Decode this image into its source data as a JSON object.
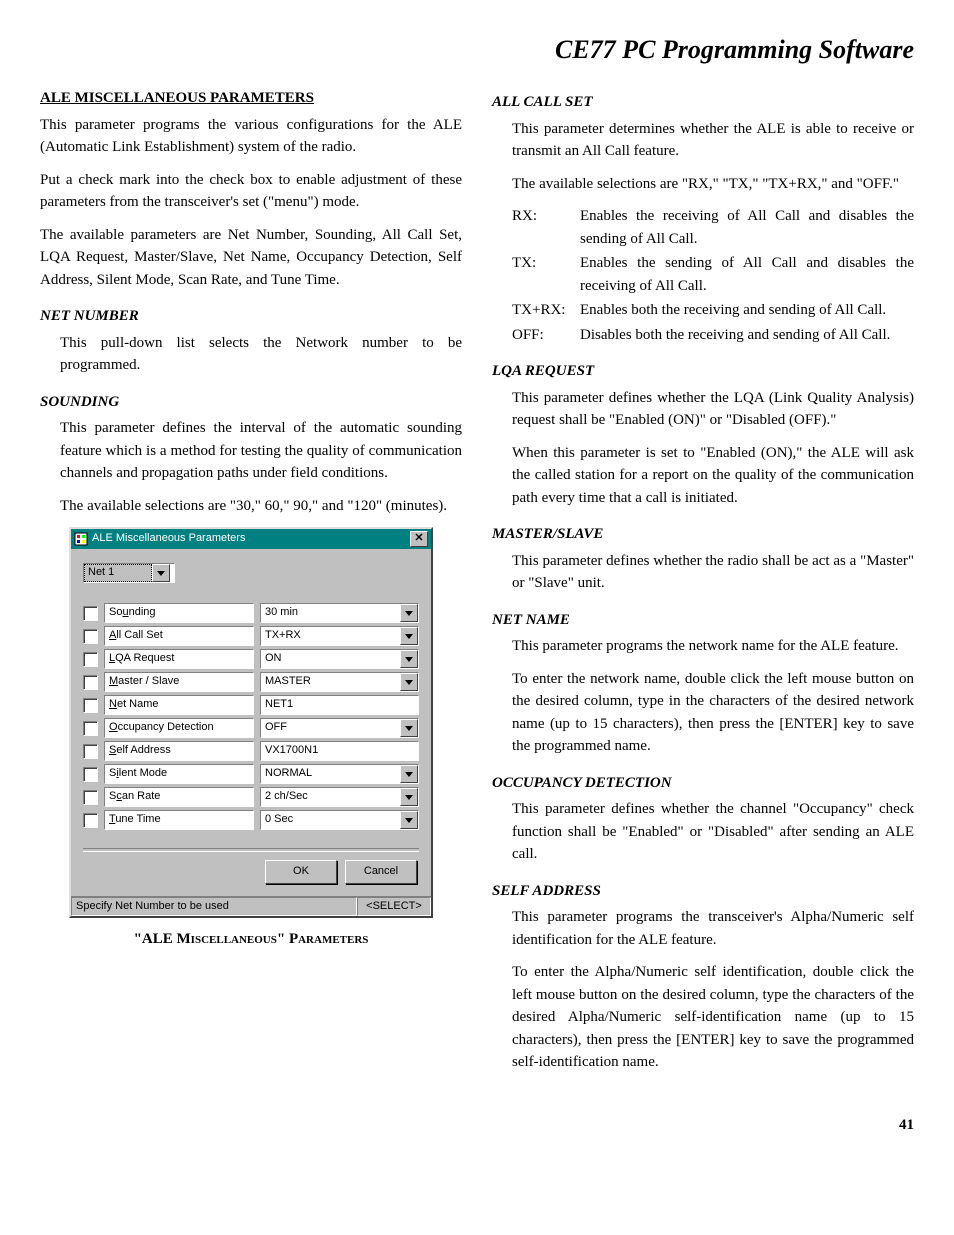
{
  "mainTitle": "CE77 PC Programming Software",
  "pageNumber": "41",
  "left": {
    "h1": "ALE MISCELLANEOUS PARAMETERS",
    "p1": "This parameter programs the various configurations for the ALE (Automatic Link Establishment) system of the radio.",
    "p2": "Put a check mark into the check box to enable adjustment of these parameters from the transceiver's set (\"menu\") mode.",
    "p3": "The available parameters are Net Number, Sounding, All Call Set, LQA Request, Master/Slave, Net Name, Occupancy Detection, Self Address, Silent Mode, Scan Rate, and Tune Time.",
    "netNumber": {
      "title": "NET NUMBER",
      "p1": "This pull-down list selects the Network number to be programmed."
    },
    "sounding": {
      "title": "SOUNDING",
      "p1": "This parameter defines the interval of the automatic sounding feature which is a method for testing the quality of communication channels and propagation paths under field conditions.",
      "p2": "The available selections are \"30,\" 60,\" 90,\" and \"120\" (minutes)."
    },
    "caption": "\"ALE Miscellaneous\" Parameters"
  },
  "dialog": {
    "title": "ALE Miscellaneous Parameters",
    "netSelect": "Net 1",
    "rows": [
      {
        "labelPre": "So",
        "labelU": "u",
        "labelPost": "nding",
        "value": "30 min",
        "dropdown": true
      },
      {
        "labelPre": "",
        "labelU": "A",
        "labelPost": "ll Call Set",
        "value": "TX+RX",
        "dropdown": true
      },
      {
        "labelPre": "",
        "labelU": "L",
        "labelPost": "QA Request",
        "value": "ON",
        "dropdown": true
      },
      {
        "labelPre": "",
        "labelU": "M",
        "labelPost": "aster / Slave",
        "value": "MASTER",
        "dropdown": true
      },
      {
        "labelPre": "",
        "labelU": "N",
        "labelPost": "et Name",
        "value": "NET1",
        "dropdown": false
      },
      {
        "labelPre": "",
        "labelU": "O",
        "labelPost": "ccupancy Detection",
        "value": "OFF",
        "dropdown": true
      },
      {
        "labelPre": "",
        "labelU": "S",
        "labelPost": "elf Address",
        "value": "VX1700N1",
        "dropdown": false
      },
      {
        "labelPre": "S",
        "labelU": "i",
        "labelPost": "lent Mode",
        "value": "NORMAL",
        "dropdown": true
      },
      {
        "labelPre": "S",
        "labelU": "c",
        "labelPost": "an Rate",
        "value": "2 ch/Sec",
        "dropdown": true
      },
      {
        "labelPre": "",
        "labelU": "T",
        "labelPost": "une Time",
        "value": "0 Sec",
        "dropdown": true
      }
    ],
    "ok": "OK",
    "cancel": "Cancel",
    "status": "Specify Net Number to be used",
    "statusRight": "<SELECT>"
  },
  "right": {
    "allCallSet": {
      "title": "ALL CALL SET",
      "p1": "This parameter determines whether the ALE is able to receive or transmit an All Call feature.",
      "p2": "The available selections are \"RX,\" \"TX,\" \"TX+RX,\" and \"OFF.\"",
      "items": [
        {
          "term": "RX:",
          "def": "Enables the receiving of All Call and disables the sending of All Call."
        },
        {
          "term": "TX:",
          "def": "Enables the sending of All Call and disables the receiving of All Call."
        },
        {
          "term": "TX+RX:",
          "def": "Enables both the receiving and sending of All Call."
        },
        {
          "term": "OFF:",
          "def": "Disables both the receiving and sending of All Call."
        }
      ]
    },
    "lqa": {
      "title": "LQA REQUEST",
      "p1": "This parameter defines whether the LQA (Link Quality Analysis) request shall be \"Enabled (ON)\" or \"Disabled (OFF).\"",
      "p2": "When this parameter is set to \"Enabled (ON),\" the ALE will ask the called station for a report on the quality of the communication path every time that a call is initiated."
    },
    "masterSlave": {
      "title": "MASTER/SLAVE",
      "p1": "This parameter defines whether the radio shall be act as a \"Master\" or \"Slave\" unit."
    },
    "netName": {
      "title": "NET NAME",
      "p1": "This parameter programs the network name for the ALE feature.",
      "p2": "To enter the network name, double click the left mouse button on the desired column, type in the characters of the desired network name (up to 15 characters), then press the [ENTER] key to save the programmed name."
    },
    "occ": {
      "title": "OCCUPANCY DETECTION",
      "p1": "This parameter defines whether the channel \"Occupancy\" check function shall be \"Enabled\" or \"Disabled\" after sending an ALE call."
    },
    "selfAddr": {
      "title": "SELF ADDRESS",
      "p1": "This parameter programs the transceiver's Alpha/Numeric self identification for the ALE feature.",
      "p2": "To enter the Alpha/Numeric self identification, double click the left mouse button on the desired column, type the characters of the desired Alpha/Numeric self-identification name (up to 15 characters), then press the [ENTER] key to save the programmed self-identification name."
    }
  }
}
